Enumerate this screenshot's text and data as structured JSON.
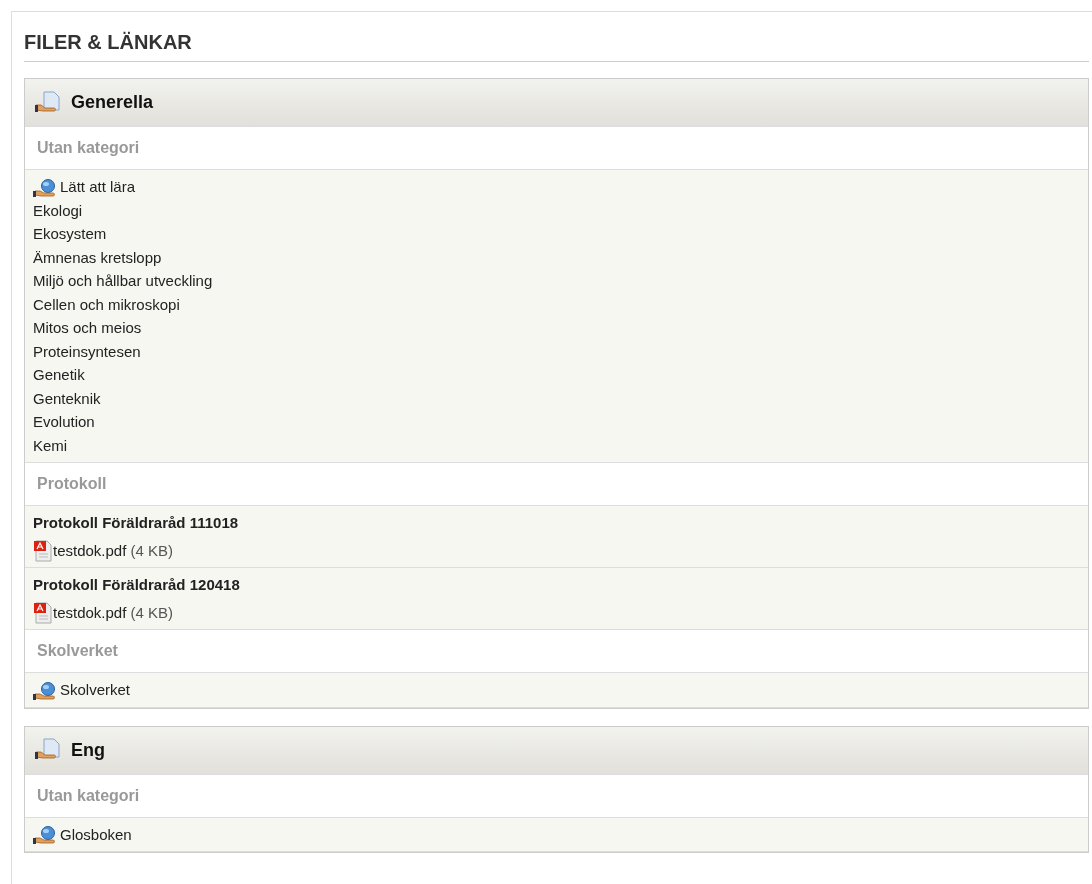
{
  "heading": "FILER & LÄNKAR",
  "sections": [
    {
      "title": "Generella",
      "categories": [
        {
          "name": "Utan kategori",
          "entries": [
            {
              "kind": "link",
              "title": "Lätt att lära",
              "lines": [
                "Ekologi",
                "Ekosystem",
                "Ämnenas kretslopp",
                "Miljö och hållbar utveckling",
                "Cellen och mikroskopi",
                "Mitos och meios",
                "Proteinsyntesen",
                "Genetik",
                "Genteknik",
                "Evolution",
                "Kemi"
              ]
            }
          ]
        },
        {
          "name": "Protokoll",
          "entries": [
            {
              "kind": "document",
              "title": "Protokoll Föräldraråd 111018",
              "file": "testdok.pdf",
              "size": "(4 KB)"
            },
            {
              "kind": "document",
              "title": "Protokoll Föräldraråd 120418",
              "file": "testdok.pdf",
              "size": "(4 KB)"
            }
          ]
        },
        {
          "name": "Skolverket",
          "entries": [
            {
              "kind": "link",
              "title": "Skolverket"
            }
          ]
        }
      ]
    },
    {
      "title": "Eng",
      "categories": [
        {
          "name": "Utan kategori",
          "entries": [
            {
              "kind": "link",
              "title": "Glosboken"
            }
          ]
        }
      ]
    }
  ]
}
